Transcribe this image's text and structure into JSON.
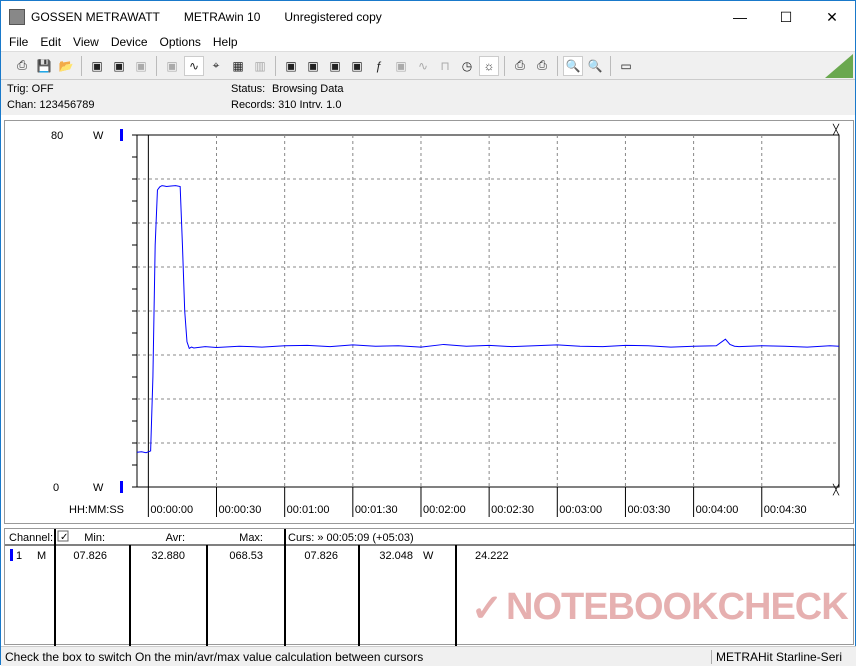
{
  "window": {
    "title_parts": [
      "GOSSEN METRAWATT",
      "METRAwin 10",
      "Unregistered copy"
    ],
    "controls": [
      "—",
      "☐",
      "✕"
    ]
  },
  "menu": [
    "File",
    "Edit",
    "View",
    "Device",
    "Options",
    "Help"
  ],
  "toolbar_icons": [
    "export-icon",
    "save-icon",
    "open-icon",
    "device-read-icon",
    "device-icon",
    "memory-icon",
    "print-list-icon",
    "curve-icon",
    "crosshair-icon",
    "table-icon",
    "histogram-icon",
    "copy-icon",
    "transfer-icon",
    "list-icon",
    "monitor-icon",
    "function-icon",
    "meter-icon",
    "wave-icon",
    "pulse-icon",
    "clock-icon",
    "trigger-icon",
    "print-icon",
    "printer-icon",
    "zoom-wave-icon",
    "zoom-icon",
    "comment-icon"
  ],
  "info": {
    "trig": "Trig: OFF",
    "chan": "Chan:  123456789",
    "status_label": "Status:",
    "status_value": "Browsing Data",
    "records": "Records: 310  Intrv. 1.0"
  },
  "chart_data": {
    "type": "line",
    "ylim": [
      0,
      80
    ],
    "y_tick_labels": [
      "80",
      "0"
    ],
    "y_unit": "W",
    "xlabel": "HH:MM:SS",
    "xlim": [
      -5,
      304
    ],
    "x_tick_labels": [
      "00:00:00",
      "00:00:30",
      "00:01:00",
      "00:01:30",
      "00:02:00",
      "00:02:30",
      "00:03:00",
      "00:03:30",
      "00:04:00",
      "00:04:30"
    ],
    "grid": true,
    "color": "#0000ff",
    "series": [
      {
        "x": [
          -5,
          -3,
          -1,
          0,
          1,
          2,
          3,
          4,
          5,
          6,
          7,
          8,
          10,
          12,
          14,
          15,
          16,
          17,
          18,
          19,
          20,
          25,
          30,
          40,
          50,
          60,
          70,
          80,
          90,
          100,
          110,
          120,
          130,
          140,
          150,
          160,
          170,
          180,
          190,
          200,
          210,
          220,
          230,
          240,
          250,
          254,
          256,
          258,
          260,
          270,
          280,
          290,
          300,
          304
        ],
        "y": [
          7.9,
          8.0,
          7.8,
          8.0,
          8.2,
          25,
          55,
          67.5,
          68.2,
          68.5,
          68.4,
          68.3,
          68.4,
          68.5,
          68.3,
          55,
          40,
          33,
          31.5,
          31.8,
          31.6,
          31.9,
          31.7,
          32.0,
          31.8,
          32.1,
          32.2,
          31.9,
          32.3,
          32.0,
          32.1,
          31.8,
          32.4,
          32.0,
          32.2,
          31.9,
          32.1,
          32.3,
          32.0,
          31.9,
          32.2,
          32.1,
          31.8,
          32.0,
          32.1,
          33.6,
          32.4,
          32.0,
          31.9,
          32.1,
          32.0,
          31.8,
          32.1,
          32.0
        ]
      }
    ]
  },
  "table": {
    "channel_header": "Channel:",
    "min_header": "Min:",
    "avr_header": "Avr:",
    "max_header": "Max:",
    "curs_header": "Curs: » 00:05:09 (+05:03)",
    "row": {
      "ch": "1",
      "mode": "M",
      "min": "07.826",
      "avr": "32.880",
      "max": "068.53",
      "c1": "07.826",
      "c2": "32.048",
      "unit": "W",
      "c3": "24.222"
    }
  },
  "watermark": "NOTEBOOKCHECK",
  "status": {
    "hint": "Check the box to switch On the min/avr/max value calculation between cursors",
    "device": "METRAHit Starline-Seri"
  }
}
